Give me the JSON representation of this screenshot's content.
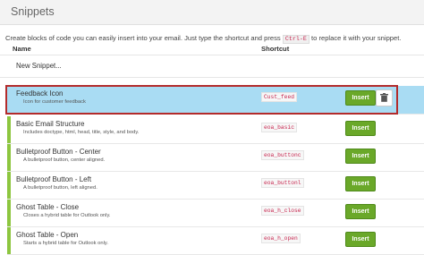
{
  "header": {
    "title": "Snippets"
  },
  "description": {
    "text_before": "Create blocks of code you can easily insert into your email. Just type the shortcut and press ",
    "key": "Ctrl-E",
    "text_after": " to replace it with your snippet."
  },
  "columns": {
    "name": "Name",
    "shortcut": "Shortcut"
  },
  "new_snippet": "New Snippet...",
  "insert_label": "Insert",
  "snippets": [
    {
      "name": "Feedback Icon",
      "description": "Icon for customer feedback",
      "shortcut": "Cust_feed",
      "selected": true
    },
    {
      "name": "Basic Email Structure",
      "description": "Includes doctype, html, head, title, style, and body.",
      "shortcut": "eoa_basic"
    },
    {
      "name": "Bulletproof Button - Center",
      "description": "A bulletproof button, center aligned.",
      "shortcut": "eoa_buttonc"
    },
    {
      "name": "Bulletproof Button - Left",
      "description": "A bulletproof button, left aligned.",
      "shortcut": "eoa_buttonl"
    },
    {
      "name": "Ghost Table - Close",
      "description": "Closes a hybrid table for Outlook only.",
      "shortcut": "eoa_h_close"
    },
    {
      "name": "Ghost Table - Open",
      "description": "Starts a hybrid table for Outlook only.",
      "shortcut": "eoa_h_open"
    }
  ],
  "colors": {
    "accent_green": "#8dc63f",
    "insert_green": "#6aa829",
    "selected_bg": "#a9dcf3",
    "highlight_border": "#b32b2b",
    "shortcut_text": "#c7254e"
  },
  "icons": {
    "delete": "trash-icon"
  }
}
